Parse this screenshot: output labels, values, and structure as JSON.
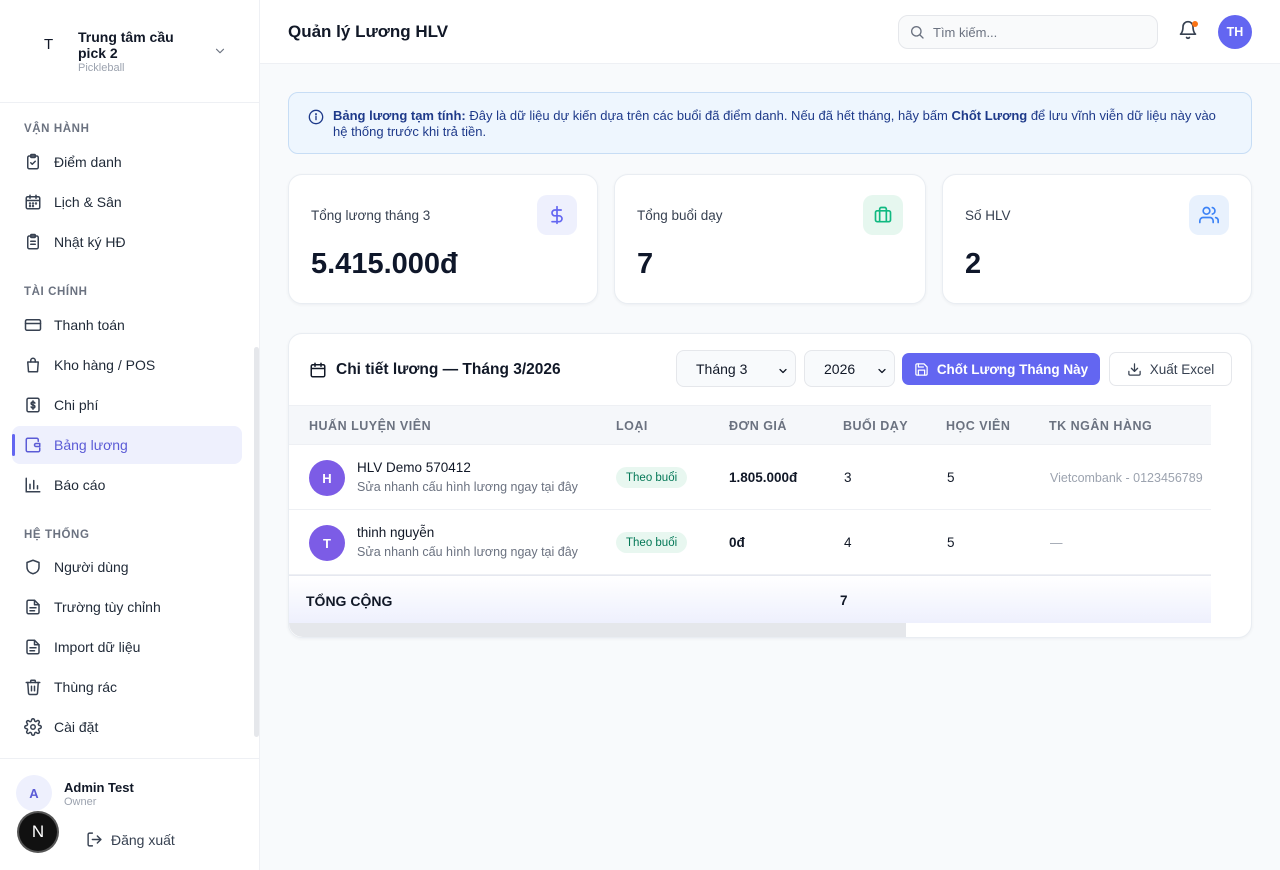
{
  "sidebar": {
    "brand": {
      "letter": "T",
      "name": "Trung tâm cầu pick 2",
      "subtitle": "Pickleball"
    },
    "sections": {
      "ops": "VẬN HÀNH",
      "finance": "TÀI CHÍNH",
      "system": "HỆ THỐNG"
    },
    "items": {
      "attendance": "Điểm danh",
      "schedule": "Lịch & Sân",
      "activity_log": "Nhật ký HĐ",
      "payment": "Thanh toán",
      "inventory": "Kho hàng / POS",
      "expenses": "Chi phí",
      "payroll": "Bảng lương",
      "reports": "Báo cáo",
      "users": "Người dùng",
      "custom_fields": "Trường tùy chỉnh",
      "import": "Import dữ liệu",
      "trash": "Thùng rác",
      "settings": "Cài đặt"
    },
    "active_item": "payroll",
    "user": {
      "initial": "A",
      "name": "Admin Test",
      "role": "Owner"
    },
    "logout": "Đăng xuất",
    "dev_badge": "N"
  },
  "header": {
    "title": "Quản lý Lương HLV",
    "search_placeholder": "Tìm kiếm...",
    "avatar_initials": "TH",
    "notification_dot": true
  },
  "banner": {
    "lead": "Bảng lương tạm tính:",
    "text_1": " Đây là dữ liệu dự kiến dựa trên các buổi đã điểm danh. Nếu đã hết tháng, hãy bấm ",
    "emphasis": "Chốt Lương",
    "text_2": " để lưu vĩnh viễn dữ liệu này vào hệ thống trước khi trả tiền."
  },
  "stats": [
    {
      "label": "Tổng lương tháng 3",
      "value": "5.415.000đ",
      "icon": "dollar-icon",
      "color": "#6366f1"
    },
    {
      "label": "Tổng buổi dạy",
      "value": "7",
      "icon": "briefcase-icon",
      "color": "#10b981"
    },
    {
      "label": "Số HLV",
      "value": "2",
      "icon": "users-icon",
      "color": "#3b82f6"
    }
  ],
  "table": {
    "title": "Chi tiết lương — Tháng 3/2026",
    "month_select": "Tháng 3",
    "year_select": "2026",
    "primary_button": "Chốt Lương Tháng Này",
    "export_button": "Xuất Excel",
    "columns": [
      "HUẤN LUYỆN VIÊN",
      "LOẠI",
      "ĐƠN GIÁ",
      "BUỔI DẠY",
      "HỌC VIÊN",
      "TK NGÂN HÀNG"
    ],
    "rows": [
      {
        "initial": "H",
        "name": "HLV Demo 570412",
        "sub": "Sửa nhanh cấu hình lương ngay tại đây",
        "type": "Theo buổi",
        "rate": "1.805.000đ",
        "sessions": "3",
        "students": "5",
        "bank": "Vietcombank - 0123456789"
      },
      {
        "initial": "T",
        "name": "thinh nguyễn",
        "sub": "Sửa nhanh cấu hình lương ngay tại đây",
        "type": "Theo buổi",
        "rate": "0đ",
        "sessions": "4",
        "students": "5",
        "bank": "—"
      }
    ],
    "total_label": "TỔNG CỘNG",
    "total_sessions": "7"
  }
}
